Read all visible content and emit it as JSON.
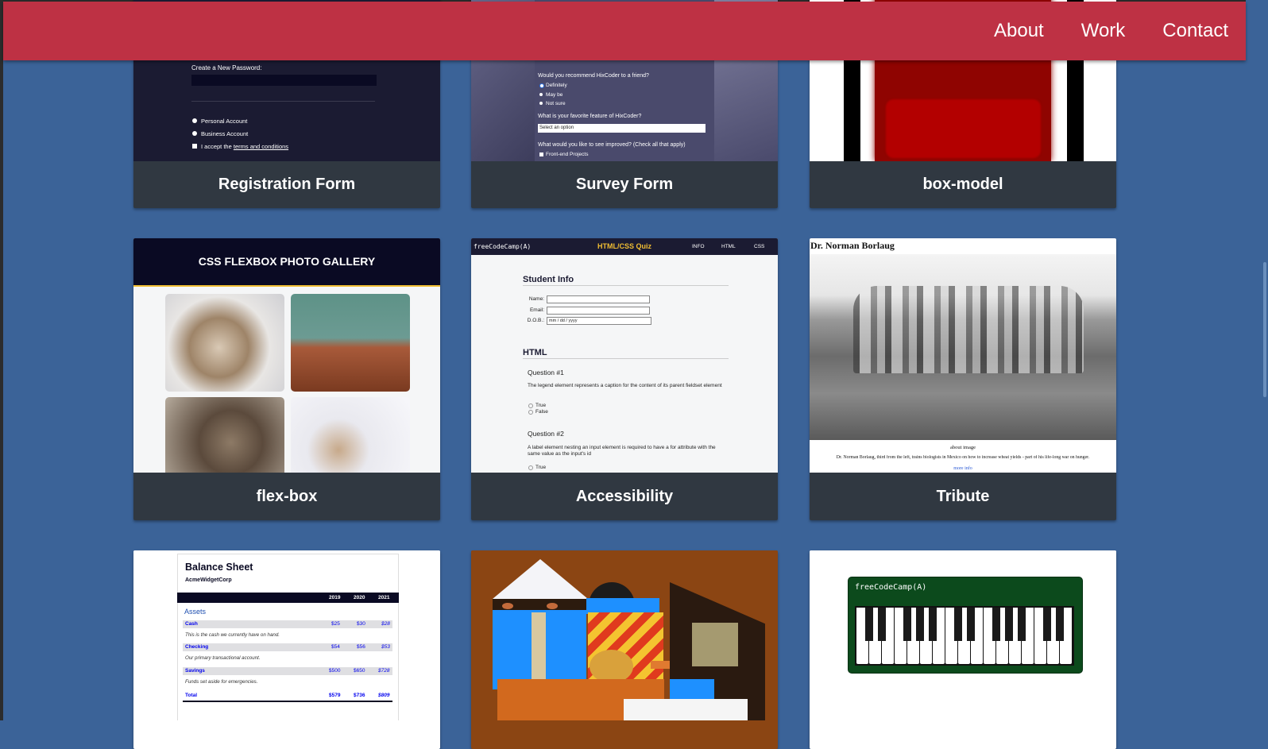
{
  "nav": {
    "links": [
      "About",
      "Work",
      "Contact"
    ]
  },
  "projects": [
    {
      "title": "Registration Form"
    },
    {
      "title": "Survey Form"
    },
    {
      "title": "box-model"
    },
    {
      "title": "flex-box"
    },
    {
      "title": "Accessibility"
    },
    {
      "title": "Tribute"
    },
    {
      "title": ""
    },
    {
      "title": ""
    },
    {
      "title": ""
    }
  ],
  "registration": {
    "password_label": "Create a New Password:",
    "opt1": "Personal Account",
    "opt2": "Business Account",
    "accept_prefix": "I accept the ",
    "accept_link": "terms and conditions"
  },
  "survey": {
    "q1": "Would you recommend HixCoder to a friend?",
    "r1": "Definitely",
    "r2": "May be",
    "r3": "Not sure",
    "q2": "What is your favorite feature of HixCoder?",
    "select": "Select an option",
    "q3": "What would you like to see improved? (Check all that apply)",
    "c1": "Front-end Projects"
  },
  "flexbox": {
    "header": "CSS FLEXBOX PHOTO GALLERY"
  },
  "quiz": {
    "brand": "freeCodeCamp(A)",
    "title": "HTML/CSS Quiz",
    "nav": [
      "INFO",
      "HTML",
      "CSS"
    ],
    "section1": "Student Info",
    "name": "Name:",
    "email": "Email:",
    "dob": "D.O.B.:",
    "dob_placeholder": "mm / dd / yyyy",
    "section2": "HTML",
    "q1": "Question #1",
    "q1text": "The legend element represents a caption for the content of its parent fieldset element",
    "t": "True",
    "f": "False",
    "q2": "Question #2",
    "q2text": "A label element nesting an input element is required to have a for attribute with the same value as the input's id"
  },
  "tribute": {
    "name": "Dr. Norman Borlaug",
    "about": "about image",
    "caption": "Dr. Norman Borlaug, third from the left, trains biologists in Mexico on how to increase wheat yields - part of his life-long war on hunger.",
    "more": "more info"
  },
  "balance": {
    "title": "Balance Sheet",
    "company": "AcmeWidgetCorp",
    "years": [
      "2019",
      "2020",
      "2021"
    ],
    "section": "Assets",
    "rows": [
      {
        "label": "Cash",
        "v": [
          "$25",
          "$30",
          "$28"
        ],
        "note": "This is the cash we currently have on hand."
      },
      {
        "label": "Checking",
        "v": [
          "$54",
          "$56",
          "$53"
        ],
        "note": "Our primary transactional account."
      },
      {
        "label": "Savings",
        "v": [
          "$500",
          "$650",
          "$728"
        ],
        "note": "Funds set aside for emergencies."
      }
    ],
    "total": {
      "label": "Total",
      "v": [
        "$579",
        "$736",
        "$809"
      ]
    }
  },
  "piano": {
    "brand": "freeCodeCamp(A)"
  },
  "colors": {
    "nav": "#be3144",
    "bg": "#3b6398",
    "card": "#303841"
  }
}
